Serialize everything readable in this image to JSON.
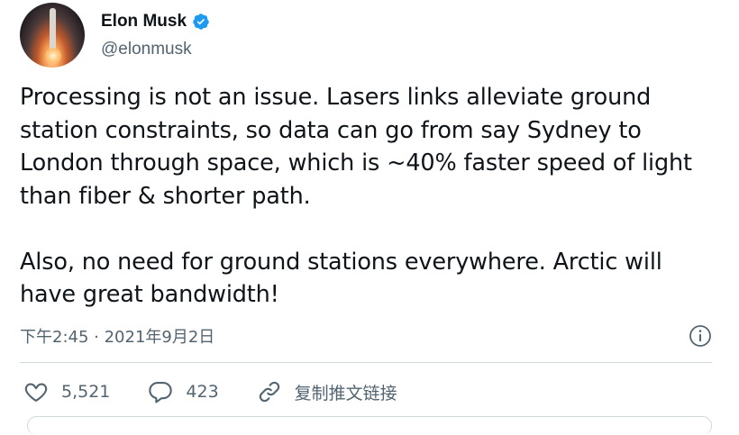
{
  "author": {
    "name": "Elon Musk",
    "handle": "@elonmusk"
  },
  "tweet": {
    "paragraph1": "Processing is not an issue. Lasers links alleviate ground station constraints, so data can go from say Sydney to London through space, which is ~40% faster speed of light than fiber & shorter path.",
    "paragraph2": "Also, no need for ground stations everywhere. Arctic will have great bandwidth!",
    "timestamp": "下午2:45 · 2021年9月2日"
  },
  "actions": {
    "likes": "5,521",
    "replies": "423",
    "copy_link_label": "复制推文链接"
  },
  "colors": {
    "verified": "#1d9bf0",
    "secondary_text": "#536471",
    "divider": "#cfd9de"
  }
}
